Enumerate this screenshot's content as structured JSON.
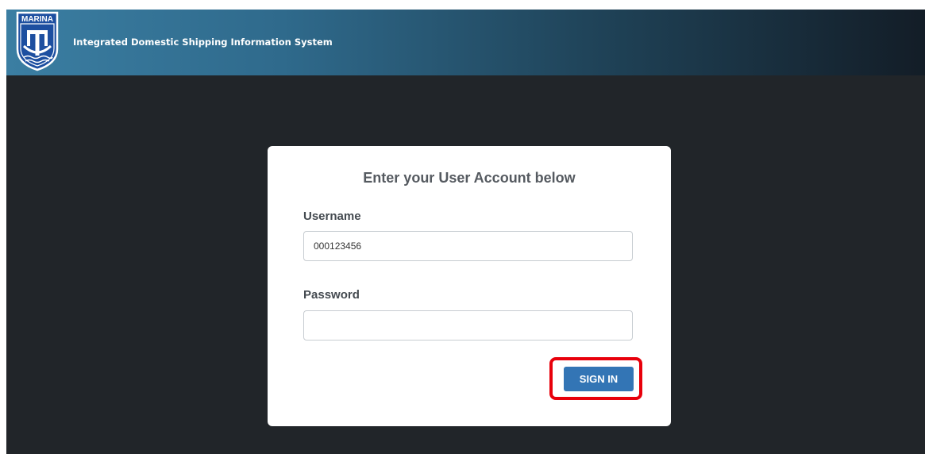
{
  "header": {
    "logo_text": "MARINA",
    "app_title": "Integrated Domestic Shipping Information System"
  },
  "login": {
    "title": "Enter your User Account below",
    "username_label": "Username",
    "username_value": "000123456",
    "password_label": "Password",
    "password_value": "",
    "signin_label": "SIGN IN"
  },
  "colors": {
    "page_background": "#212529",
    "header_gradient_start": "#3b7ea2",
    "header_gradient_end": "#131d27",
    "button": "#3375b5",
    "highlight": "#e8000b"
  }
}
